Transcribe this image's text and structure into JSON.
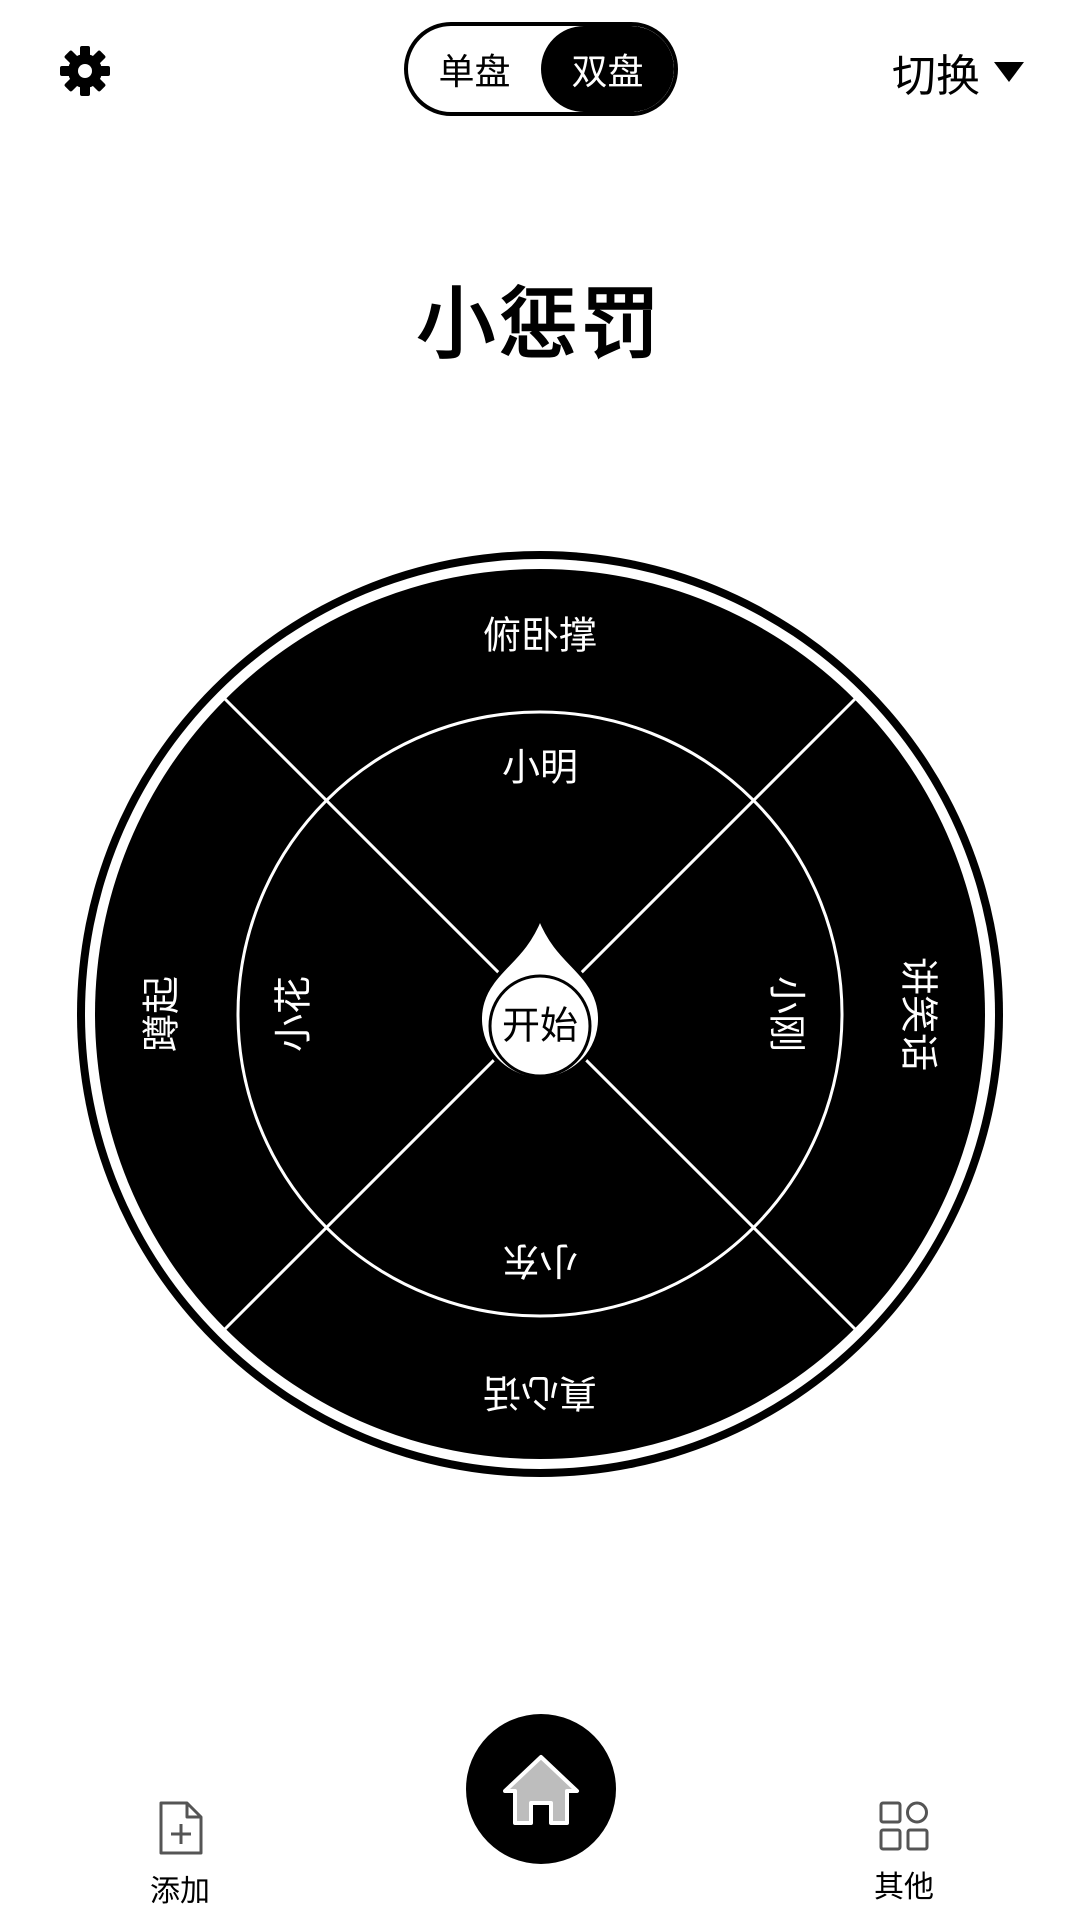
{
  "header": {
    "mode_tabs": [
      {
        "label": "单盘",
        "active": false
      },
      {
        "label": "双盘",
        "active": true
      }
    ],
    "switch_label": "切换",
    "settings_icon": "gear-icon",
    "switch_icon": "caret-down-icon"
  },
  "title": "小惩罚",
  "wheel": {
    "outer_segments": [
      "俯卧撑",
      "讲笑话",
      "真心话",
      "蹲起"
    ],
    "inner_segments": [
      "小明",
      "小刚",
      "小东",
      "小花"
    ],
    "start_label": "开始",
    "colors": {
      "segment": "#000000",
      "ring": "#ffffff",
      "text": "#ffffff"
    }
  },
  "bottom_nav": {
    "add": {
      "label": "添加",
      "icon": "add-file-icon"
    },
    "home": {
      "icon": "home-icon"
    },
    "other": {
      "label": "其他",
      "icon": "grid-icon"
    }
  }
}
